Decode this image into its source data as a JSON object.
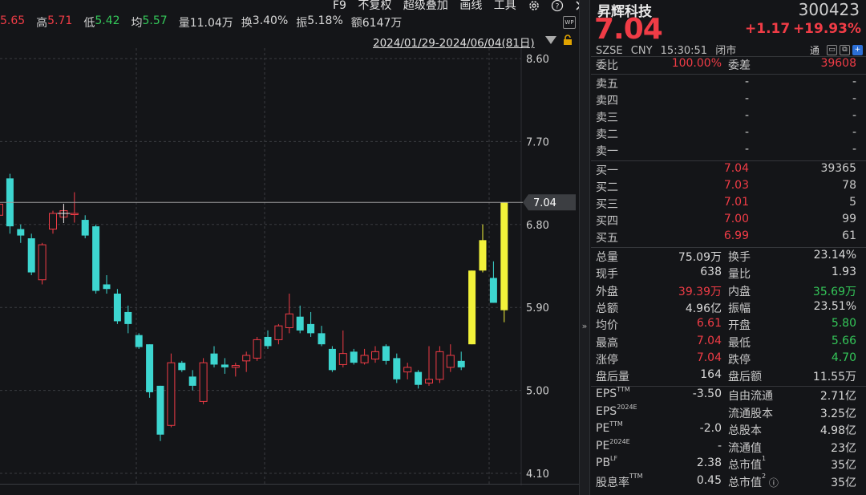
{
  "stats": {
    "open_value": "5.65",
    "high_label": "高",
    "high_value": "5.71",
    "low_label": "低",
    "low_value": "5.42",
    "avg_label": "均",
    "avg_value": "5.57",
    "volume_label": "量",
    "volume_value": "11.04万",
    "turnover_label": "换",
    "turnover_value": "3.40%",
    "amplitude_label": "振",
    "amplitude_value": "5.18%",
    "amount_label": "额",
    "amount_value": "6147万"
  },
  "toolbar": {
    "f9": "F9",
    "no_adjust": "不复权",
    "overlay": "超级叠加",
    "draw": "画线",
    "tools": "工具",
    "gear_icon": "gear-icon",
    "help_icon": "help-icon",
    "next_icon": "chevron-right-icon"
  },
  "wp_badge": "WP",
  "range_label": "2024/01/29-2024/06/04(81日)",
  "chart_data": {
    "type": "candlestick",
    "y_axis_ticks": [
      "8.60",
      "7.70",
      "6.80",
      "5.90",
      "5.00",
      "4.10"
    ],
    "ylim": [
      4.1,
      8.6
    ],
    "current_price_label": "7.04",
    "colors": {
      "up": "#f03c46",
      "down": "#3dd6d0",
      "limit_up": "#f2f23a",
      "grid": "#3a3c40",
      "crosshair": "#e8e8e8"
    },
    "candles": [
      {
        "o": 6.9,
        "h": 7.1,
        "l": 6.75,
        "c": 7.02
      },
      {
        "o": 7.3,
        "h": 7.35,
        "l": 6.7,
        "c": 6.78
      },
      {
        "o": 6.75,
        "h": 6.8,
        "l": 6.6,
        "c": 6.68
      },
      {
        "o": 6.65,
        "h": 6.7,
        "l": 6.25,
        "c": 6.28
      },
      {
        "o": 6.2,
        "h": 6.6,
        "l": 6.15,
        "c": 6.58
      },
      {
        "o": 6.75,
        "h": 6.95,
        "l": 6.7,
        "c": 6.92
      },
      {
        "o": 6.88,
        "h": 7.0,
        "l": 6.85,
        "c": 6.95
      },
      {
        "o": 6.92,
        "h": 7.15,
        "l": 6.82,
        "c": 6.92
      },
      {
        "o": 6.85,
        "h": 6.9,
        "l": 6.65,
        "c": 6.68
      },
      {
        "o": 6.78,
        "h": 6.8,
        "l": 6.05,
        "c": 6.08
      },
      {
        "o": 6.15,
        "h": 6.25,
        "l": 6.05,
        "c": 6.1
      },
      {
        "o": 6.05,
        "h": 6.1,
        "l": 5.72,
        "c": 5.75
      },
      {
        "o": 5.85,
        "h": 5.92,
        "l": 5.62,
        "c": 5.72
      },
      {
        "o": 5.6,
        "h": 5.62,
        "l": 5.45,
        "c": 5.47
      },
      {
        "o": 5.5,
        "h": 5.5,
        "l": 4.92,
        "c": 4.98
      },
      {
        "o": 5.05,
        "h": 5.05,
        "l": 4.45,
        "c": 4.52
      },
      {
        "o": 4.62,
        "h": 5.4,
        "l": 4.6,
        "c": 5.3
      },
      {
        "o": 5.3,
        "h": 5.32,
        "l": 5.2,
        "c": 5.22
      },
      {
        "o": 5.15,
        "h": 5.22,
        "l": 5.0,
        "c": 5.05
      },
      {
        "o": 4.88,
        "h": 5.35,
        "l": 4.85,
        "c": 5.3
      },
      {
        "o": 5.4,
        "h": 5.48,
        "l": 5.25,
        "c": 5.28
      },
      {
        "o": 5.28,
        "h": 5.35,
        "l": 5.18,
        "c": 5.25
      },
      {
        "o": 5.25,
        "h": 5.3,
        "l": 5.15,
        "c": 5.27
      },
      {
        "o": 5.32,
        "h": 5.42,
        "l": 5.2,
        "c": 5.38
      },
      {
        "o": 5.35,
        "h": 5.58,
        "l": 5.32,
        "c": 5.55
      },
      {
        "o": 5.58,
        "h": 5.65,
        "l": 5.45,
        "c": 5.48
      },
      {
        "o": 5.55,
        "h": 5.72,
        "l": 5.5,
        "c": 5.7
      },
      {
        "o": 5.68,
        "h": 6.05,
        "l": 5.62,
        "c": 5.83
      },
      {
        "o": 5.8,
        "h": 5.92,
        "l": 5.62,
        "c": 5.65
      },
      {
        "o": 5.72,
        "h": 5.85,
        "l": 5.58,
        "c": 5.62
      },
      {
        "o": 5.62,
        "h": 5.7,
        "l": 5.48,
        "c": 5.5
      },
      {
        "o": 5.45,
        "h": 5.48,
        "l": 5.2,
        "c": 5.22
      },
      {
        "o": 5.28,
        "h": 5.65,
        "l": 5.25,
        "c": 5.4
      },
      {
        "o": 5.42,
        "h": 5.45,
        "l": 5.28,
        "c": 5.3
      },
      {
        "o": 5.3,
        "h": 5.45,
        "l": 5.28,
        "c": 5.38
      },
      {
        "o": 5.34,
        "h": 5.48,
        "l": 5.3,
        "c": 5.42
      },
      {
        "o": 5.48,
        "h": 5.5,
        "l": 5.28,
        "c": 5.32
      },
      {
        "o": 5.35,
        "h": 5.4,
        "l": 5.08,
        "c": 5.12
      },
      {
        "o": 5.2,
        "h": 5.3,
        "l": 5.12,
        "c": 5.25
      },
      {
        "o": 5.2,
        "h": 5.22,
        "l": 5.02,
        "c": 5.06
      },
      {
        "o": 5.08,
        "h": 5.48,
        "l": 5.05,
        "c": 5.12
      },
      {
        "o": 5.12,
        "h": 5.48,
        "l": 5.08,
        "c": 5.42
      },
      {
        "o": 5.25,
        "h": 5.5,
        "l": 5.2,
        "c": 5.38
      },
      {
        "o": 5.32,
        "h": 5.42,
        "l": 5.22,
        "c": 5.25
      },
      {
        "o": 5.5,
        "h": 6.3,
        "l": 5.5,
        "c": 6.3
      },
      {
        "o": 6.3,
        "h": 6.8,
        "l": 6.28,
        "c": 6.63
      },
      {
        "o": 6.22,
        "h": 6.4,
        "l": 5.95,
        "c": 5.95
      },
      {
        "o": 5.87,
        "h": 7.04,
        "l": 5.74,
        "c": 7.04
      }
    ]
  },
  "quote": {
    "name": "昇辉科技",
    "code": "300423",
    "price": "7.04",
    "change": "+1.17",
    "change_pct": "+19.93%",
    "exchange": "SZSE",
    "currency": "CNY",
    "time": "15:30:51",
    "status": "闭市",
    "tong": "通",
    "weibi_label": "委比",
    "weibi_value": "100.00%",
    "weicha_label": "委差",
    "weicha_value": "39608",
    "asks": [
      {
        "label": "卖五",
        "price": "-",
        "vol": "-"
      },
      {
        "label": "卖四",
        "price": "-",
        "vol": "-"
      },
      {
        "label": "卖三",
        "price": "-",
        "vol": "-"
      },
      {
        "label": "卖二",
        "price": "-",
        "vol": "-"
      },
      {
        "label": "卖一",
        "price": "-",
        "vol": "-"
      }
    ],
    "bids": [
      {
        "label": "买一",
        "price": "7.04",
        "vol": "39365"
      },
      {
        "label": "买二",
        "price": "7.03",
        "vol": "78"
      },
      {
        "label": "买三",
        "price": "7.01",
        "vol": "5"
      },
      {
        "label": "买四",
        "price": "7.00",
        "vol": "99"
      },
      {
        "label": "买五",
        "price": "6.99",
        "vol": "61"
      }
    ],
    "stats": [
      {
        "l1": "总量",
        "v1": "75.09万",
        "c1": "w",
        "l2": "换手",
        "v2": "23.14%",
        "c2": "w"
      },
      {
        "l1": "现手",
        "v1": "638",
        "c1": "w",
        "l2": "量比",
        "v2": "1.93",
        "c2": "w"
      },
      {
        "l1": "外盘",
        "v1": "39.39万",
        "c1": "up",
        "l2": "内盘",
        "v2": "35.69万",
        "c2": "down"
      },
      {
        "l1": "总额",
        "v1": "4.96亿",
        "c1": "w",
        "l2": "振幅",
        "v2": "23.51%",
        "c2": "w"
      },
      {
        "l1": "均价",
        "v1": "6.61",
        "c1": "up",
        "l2": "开盘",
        "v2": "5.80",
        "c2": "down"
      },
      {
        "l1": "最高",
        "v1": "7.04",
        "c1": "up",
        "l2": "最低",
        "v2": "5.66",
        "c2": "down"
      },
      {
        "l1": "涨停",
        "v1": "7.04",
        "c1": "up",
        "l2": "跌停",
        "v2": "4.70",
        "c2": "down"
      },
      {
        "l1": "盘后量",
        "v1": "164",
        "c1": "w",
        "l2": "盘后额",
        "v2": "11.55万",
        "c2": "w"
      }
    ],
    "fundamentals": [
      {
        "l1": "EPS",
        "s1": "TTM",
        "v1": "-3.50",
        "l2": "自由流通",
        "s2": "",
        "v2": "2.71亿"
      },
      {
        "l1": "EPS",
        "s1": "2024E",
        "v1": "",
        "l2": "流通股本",
        "s2": "",
        "v2": "3.25亿"
      },
      {
        "l1": "PE",
        "s1": "TTM",
        "v1": "-2.0",
        "l2": "总股本",
        "s2": "",
        "v2": "4.98亿"
      },
      {
        "l1": "PE",
        "s1": "2024E",
        "v1": "-",
        "l2": "流通值",
        "s2": "",
        "v2": "23亿"
      },
      {
        "l1": "PB",
        "s1": "LF",
        "v1": "2.38",
        "l2": "总市值",
        "s2": "1",
        "v2": "35亿"
      },
      {
        "l1": "股息率",
        "s1": "TTM",
        "v1": "0.45",
        "l2": "总市值",
        "s2": "2",
        "v2": "35亿"
      }
    ]
  }
}
